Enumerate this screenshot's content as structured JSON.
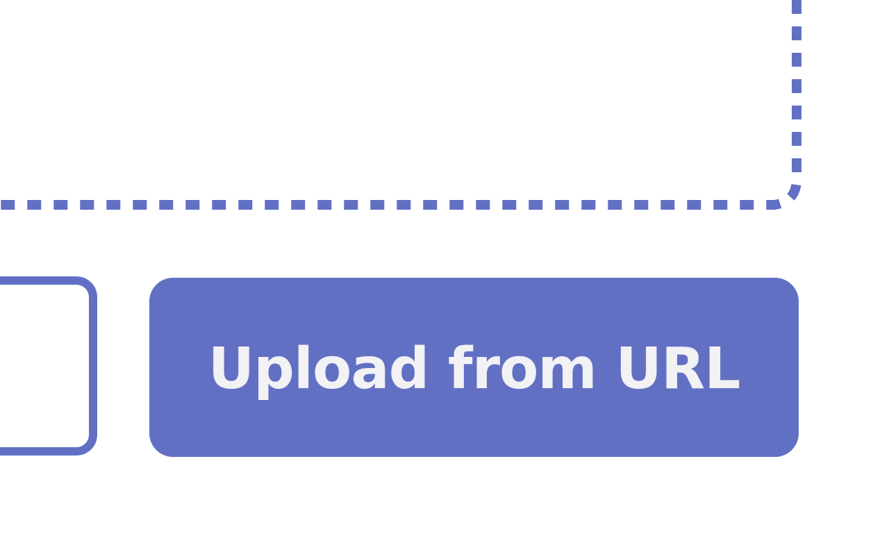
{
  "colors": {
    "accent": "#6270c4",
    "button_text": "#f2f2f5",
    "background": "#ffffff"
  },
  "upload_url_button": {
    "label": "Upload from URL"
  }
}
